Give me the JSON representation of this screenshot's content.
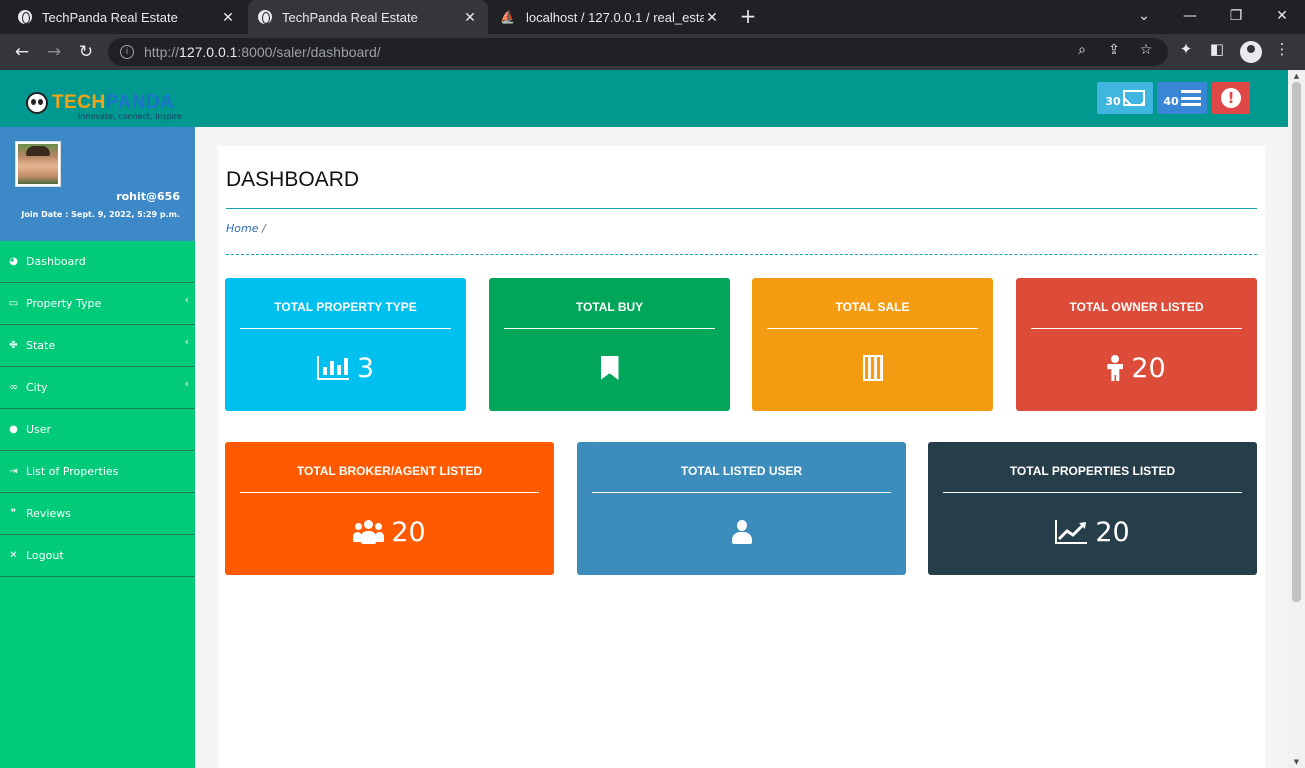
{
  "browser": {
    "tabs": [
      {
        "title": "TechPanda Real Estate"
      },
      {
        "title": "TechPanda Real Estate"
      },
      {
        "title": "localhost / 127.0.0.1 / real_estate"
      }
    ],
    "url_prefix": "http://",
    "url_host": "127.0.0.1",
    "url_rest": ":8000/saler/dashboard/"
  },
  "header": {
    "logo_part1": "TECH",
    "logo_part2": "PANDA",
    "logo_tagline": "Innovate, connect, inspire",
    "mail_count": "30",
    "menu_count": "40"
  },
  "profile": {
    "username": "rohit@656",
    "join_date": "Join Date : Sept. 9, 2022, 5:29 p.m."
  },
  "sidebar": {
    "items": [
      {
        "label": "Dashboard",
        "icon": "dashboard-icon"
      },
      {
        "label": "Property Type",
        "icon": "monitor-icon"
      },
      {
        "label": "State",
        "icon": "map-icon"
      },
      {
        "label": "City",
        "icon": "binoculars-icon"
      },
      {
        "label": "User",
        "icon": "user-icon"
      },
      {
        "label": "List of Properties",
        "icon": "sign-in-icon"
      },
      {
        "label": "Reviews",
        "icon": "quote-icon"
      },
      {
        "label": "Logout",
        "icon": "close-icon"
      }
    ]
  },
  "main": {
    "title": "DASHBOARD",
    "breadcrumb_home": "Home",
    "breadcrumb_sep": " /",
    "cards_row1": [
      {
        "title": "TOTAL PROPERTY TYPE",
        "value": "3",
        "icon": "bar-chart-icon",
        "color": "#00c0ef"
      },
      {
        "title": "TOTAL BUY",
        "value": "",
        "icon": "bookmark-icon",
        "color": "#00a65a"
      },
      {
        "title": "TOTAL SALE",
        "value": "",
        "icon": "building-icon",
        "color": "#f39c12"
      },
      {
        "title": "TOTAL OWNER LISTED",
        "value": "20",
        "icon": "child-icon",
        "color": "#dd4b39"
      }
    ],
    "cards_row2": [
      {
        "title": "TOTAL BROKER/AGENT LISTED",
        "value": "20",
        "icon": "users-icon",
        "color": "#ff5a00"
      },
      {
        "title": "TOTAL LISTED USER",
        "value": "",
        "icon": "user-icon",
        "color": "#3c8dbc"
      },
      {
        "title": "TOTAL PROPERTIES LISTED",
        "value": "20",
        "icon": "line-chart-icon",
        "color": "#263d4a"
      }
    ]
  }
}
